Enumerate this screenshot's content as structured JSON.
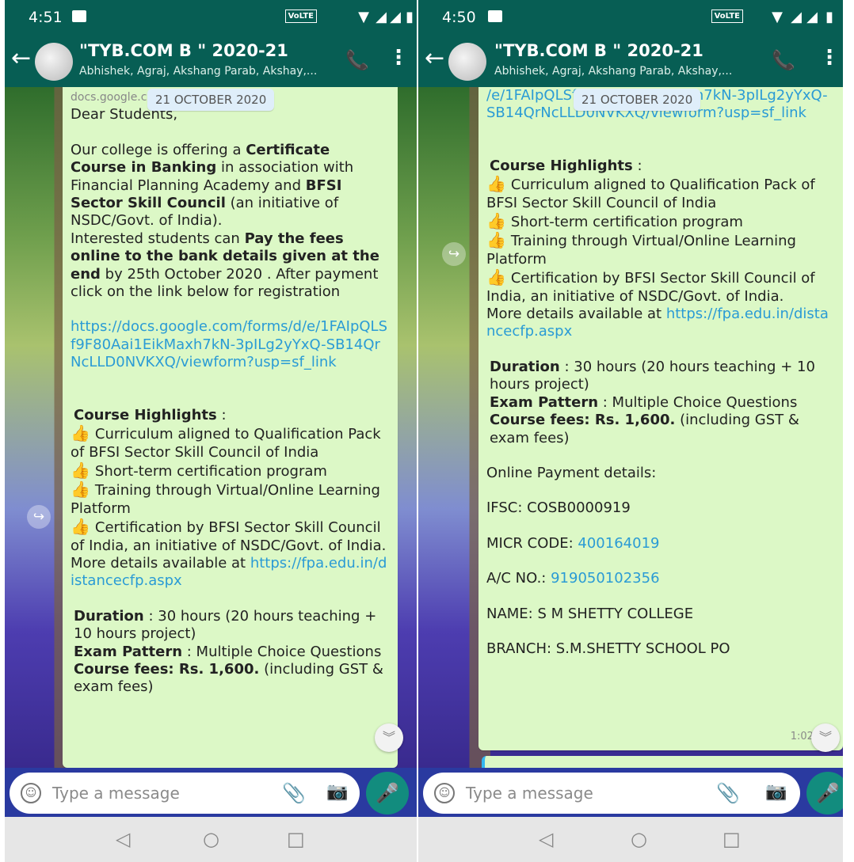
{
  "left": {
    "status": {
      "time": "4:51",
      "volte": "VoLTE"
    },
    "header": {
      "title": "\"TYB.COM B \" 2020-21",
      "subtitle": "Abhishek, Agraj, Akshang Parab, Akshay,..."
    },
    "date_chip": "21 OCTOBER 2020",
    "message": {
      "cut_top": "docs.google.com",
      "greeting": "Dear Students,",
      "p1_a": "Our college is offering a ",
      "p1_b": "Certificate Course in Banking",
      "p1_c": " in association with Financial Planning Academy and ",
      "p1_d": "BFSI Sector Skill Council",
      "p1_e": " (an initiative of NSDC/Govt. of India).",
      "p2_a": "Interested students can ",
      "p2_b": "Pay the fees online to the bank details given at the end",
      "p2_c": " by 25th October 2020 . After payment click on the link below for registration",
      "link": "https://docs.google.com/forms/d/e/1FAIpQLSf9F80Aai1EikMaxh7kN-3pILg2yYxQ-SB14QrNcLLD0NVKXQ/viewform?usp=sf_link",
      "hl_title": "Course Highlights",
      "hl_colon": " :",
      "highlights": [
        "Curriculum aligned to Qualification Pack of BFSI Sector Skill Council of India",
        "Short-term certification program",
        "Training through Virtual/Online Learning Platform",
        "Certification by BFSI Sector Skill Council of India, an initiative of NSDC/Govt. of India."
      ],
      "more_prefix": "More details available at ",
      "more_link": "https://fpa.edu.in/distancecfp.aspx",
      "duration_label": "Duration",
      "duration_text": " : 30 hours (20 hours teaching + 10 hours project)",
      "exam_label": "Exam Pattern",
      "exam_text": " : Multiple Choice Questions",
      "fees_label": "Course fees:  Rs. 1,600.",
      "fees_text": " (including GST & exam fees)"
    },
    "composer": {
      "placeholder": "Type a message"
    }
  },
  "right": {
    "status": {
      "time": "4:50",
      "volte": "VoLTE"
    },
    "header": {
      "title": "\"TYB.COM B \" 2020-21",
      "subtitle": "Abhishek, Agraj, Akshang Parab, Akshay,..."
    },
    "date_chip": "21 OCTOBER 2020",
    "message": {
      "link_tail": "/e/1FAIpQLSf9F80Aai1EikMaxh7kN-3pILg2yYxQ-SB14QrNcLLD0NVKXQ/viewform?usp=sf_link",
      "hl_title": "Course Highlights",
      "hl_colon": " :",
      "highlights": [
        "Curriculum aligned to Qualification Pack of BFSI Sector Skill Council of India",
        "Short-term certification program",
        "Training through Virtual/Online Learning Platform",
        "Certification by BFSI Sector Skill Council of India, an initiative of NSDC/Govt. of India."
      ],
      "more_prefix": "More details available at ",
      "more_link": "https://fpa.edu.in/distancecfp.aspx",
      "duration_label": "Duration",
      "duration_text": " : 30 hours (20 hours teaching + 10 hours project)",
      "exam_label": "Exam Pattern",
      "exam_text": " : Multiple Choice Questions",
      "fees_label": "Course fees:  Rs. 1,600.",
      "fees_text": " (including GST & exam fees)",
      "payment_title": "Online Payment details:",
      "ifsc": "IFSC: COSB0000919",
      "micr_label": "MICR CODE: ",
      "micr_value": "400164019",
      "ac_label": "A/C NO.: ",
      "ac_value": "919050102356",
      "name": "NAME: S M SHETTY COLLEGE",
      "branch": "BRANCH: S.M.SHETTY SCHOOL PO",
      "time": "1:02 pm"
    },
    "composer": {
      "placeholder": "Type a message"
    }
  },
  "icons": {
    "back": "←",
    "call": "📞",
    "menu": "⋮",
    "thumb": "👍",
    "forward": "↪",
    "scroll_down": "︾",
    "emoji": "☺",
    "attach": "📎",
    "camera": "📷",
    "mic": "🎤",
    "nav_back": "◁",
    "nav_home": "○",
    "nav_recent": "□"
  },
  "colors": {
    "header": "#075e54",
    "bubble": "#dcf8c6",
    "link": "#2a9bd5",
    "mic": "#128c7e"
  }
}
